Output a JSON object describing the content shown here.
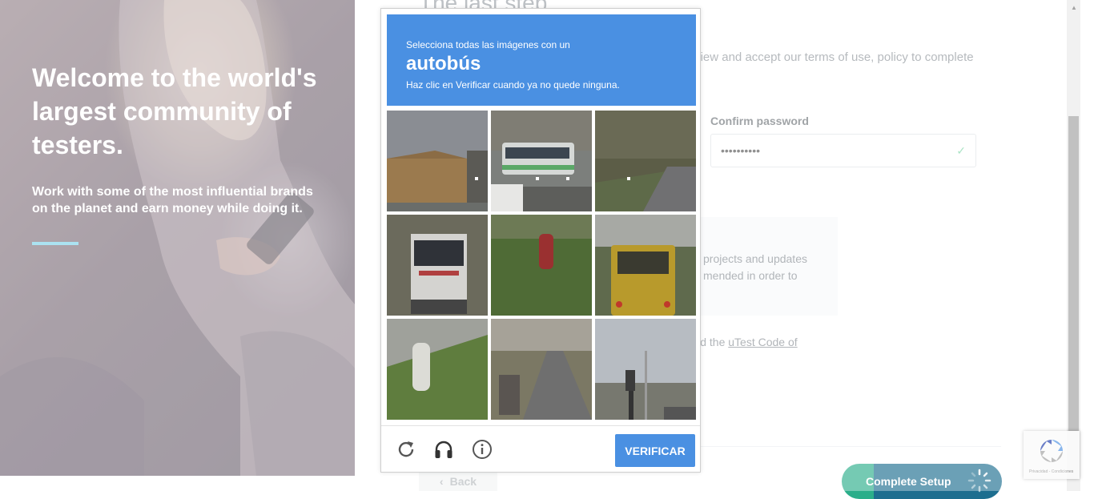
{
  "hero": {
    "title": "Welcome to the world's largest community of testers.",
    "subtitle": "Work with some of the most influential brands on the planet and earn money while doing it.",
    "accent_color": "#7fd3ea"
  },
  "form": {
    "title": "The last step",
    "description": "Please create a password for your account. Then review and accept our terms of use, policy to complete the setup process.",
    "confirm_password_label": "Confirm password",
    "confirm_password_value": "••••••••••",
    "info_text": "projects and updates\nmended in order to",
    "terms_text": "Test Terms of Use and the",
    "terms_link": "uTest Code of",
    "privacy_text": "icy",
    "back_label": "Back",
    "complete_label": "Complete Setup"
  },
  "captcha": {
    "instruction": "Selecciona todas las imágenes con un",
    "target": "autobús",
    "hint": "Haz clic en Verificar cuando ya no quede ninguna.",
    "verify_label": "VERIFICAR",
    "header_color": "#4a90e2",
    "icons": [
      "reload-icon",
      "audio-headphones-icon",
      "info-icon"
    ]
  },
  "recaptcha_badge": {
    "text": "Privacidad - Condiciones"
  }
}
